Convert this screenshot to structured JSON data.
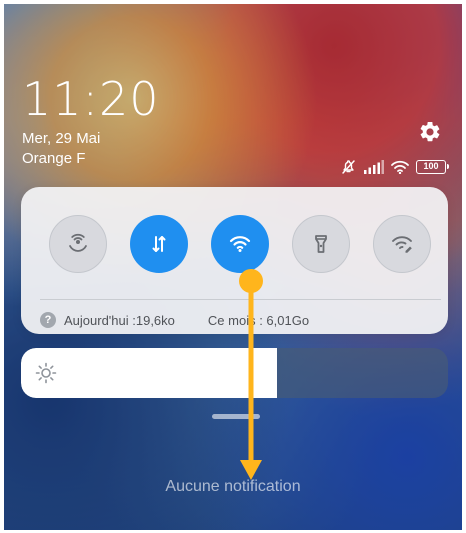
{
  "status": {
    "time": "11:20",
    "date": "Mer, 29 Mai",
    "carrier": "Orange F",
    "battery_level": "100",
    "icons": [
      "mute-icon",
      "signal-icon",
      "wifi-icon",
      "battery-icon"
    ]
  },
  "quick_settings": {
    "toggles": [
      {
        "name": "hotspot",
        "icon": "hotspot-icon",
        "state": "off"
      },
      {
        "name": "mobile-data",
        "icon": "mobile-data-icon",
        "state": "on"
      },
      {
        "name": "wifi",
        "icon": "wifi-icon",
        "state": "on"
      },
      {
        "name": "flashlight",
        "icon": "flashlight-icon",
        "state": "off"
      },
      {
        "name": "wifi-assistant",
        "icon": "wifi-edit-icon",
        "state": "off"
      }
    ],
    "data_usage": {
      "today": "Aujourd'hui :19,6ko",
      "month": "Ce mois : 6,01Go"
    }
  },
  "brightness": {
    "level": 0.6
  },
  "notifications": {
    "empty_label": "Aucune notification"
  },
  "colors": {
    "accent": "#1f8ff0",
    "annotation_arrow": "#ffb51c"
  }
}
